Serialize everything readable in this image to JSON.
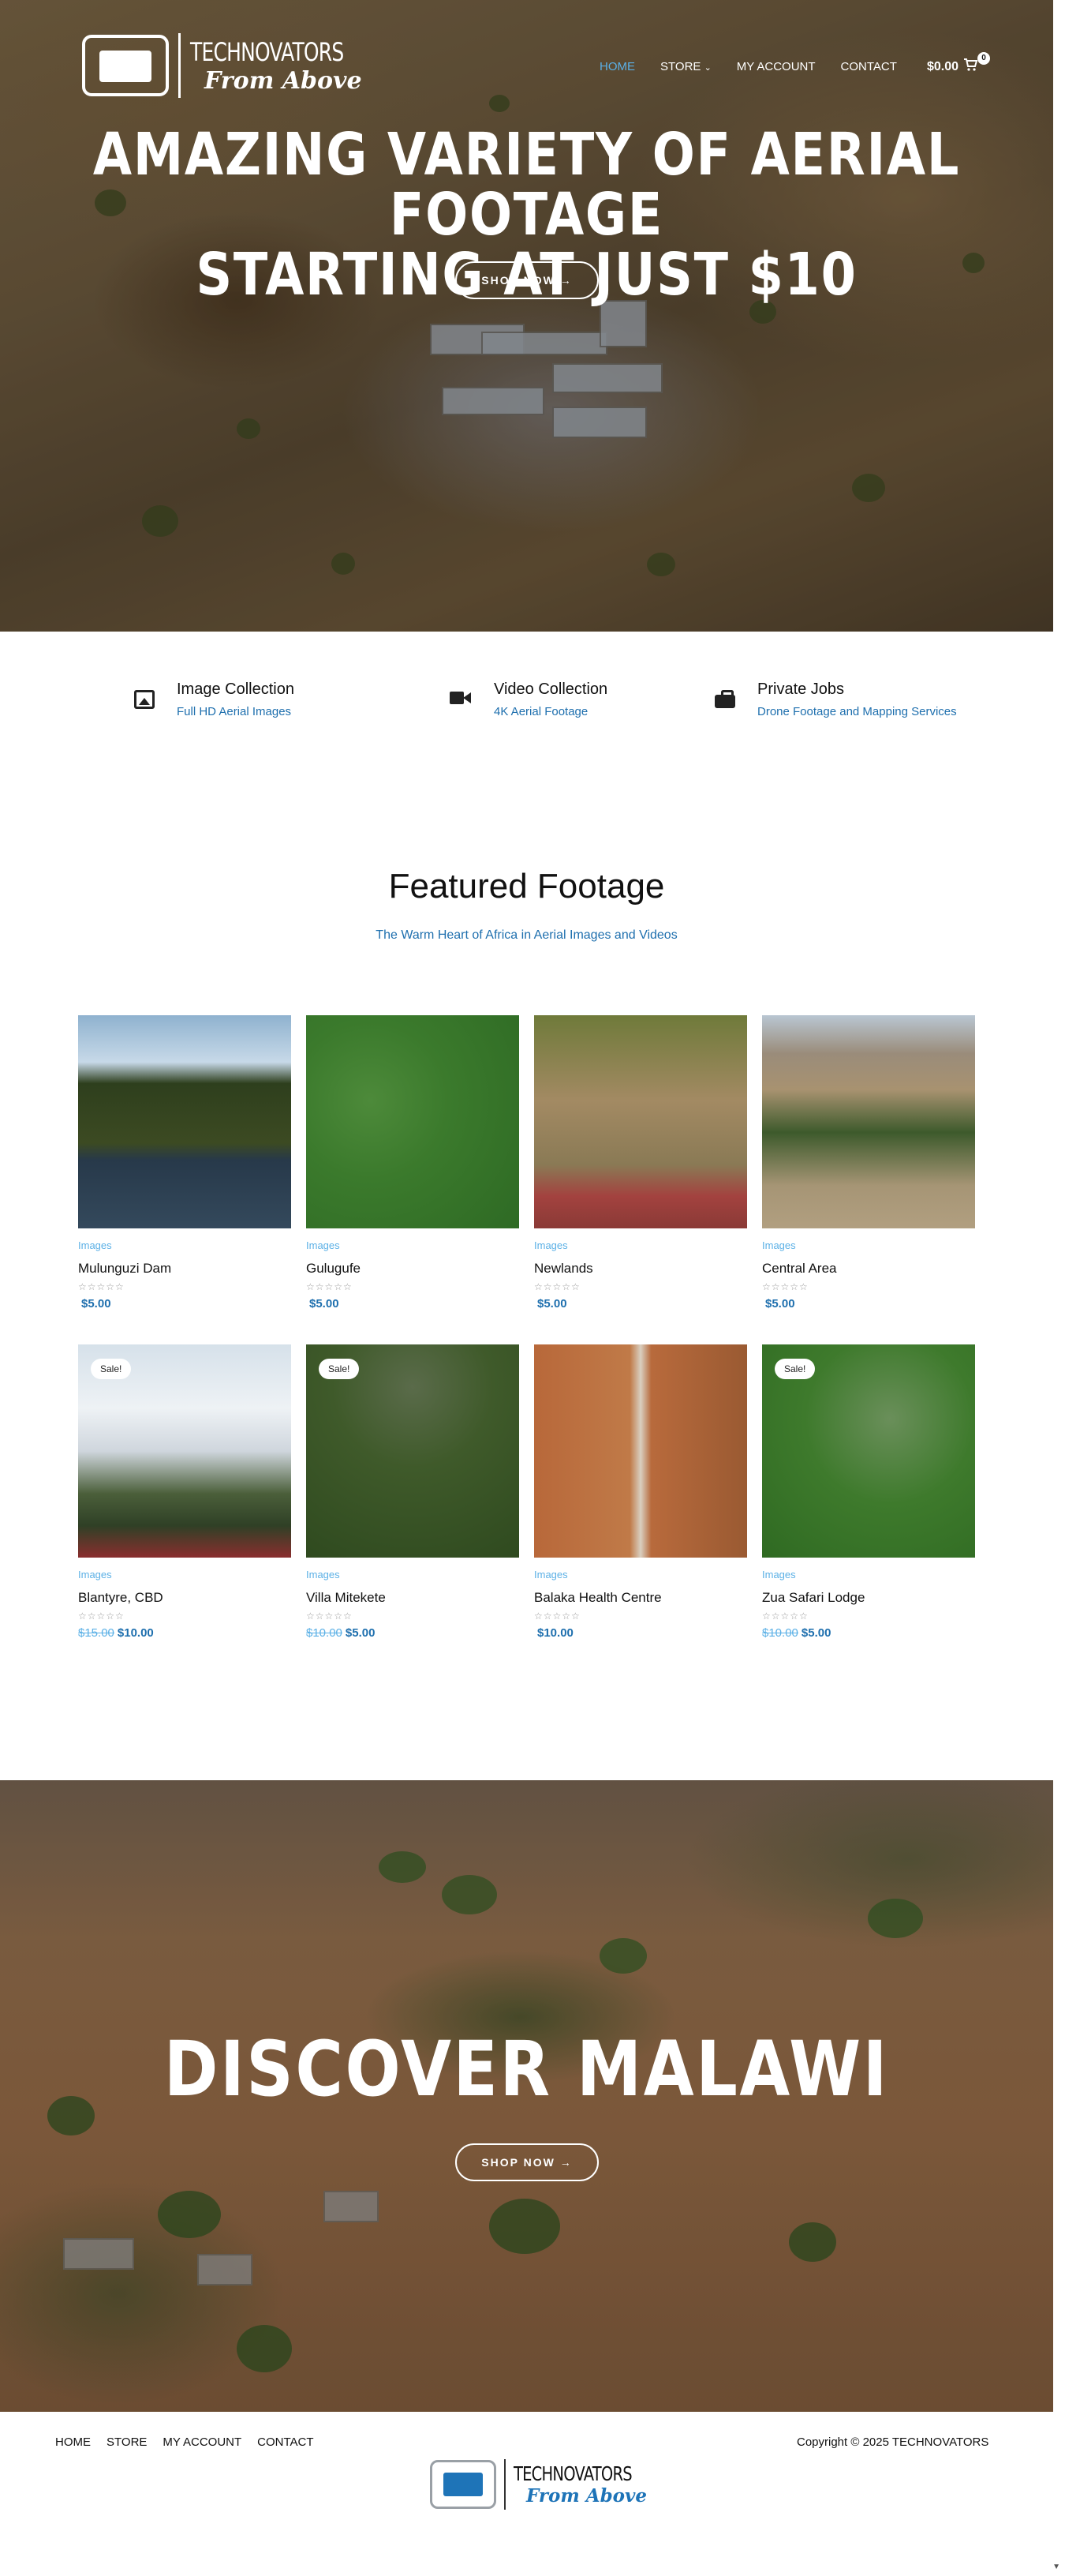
{
  "brand": {
    "logo_line1": "TECHNOVATORS",
    "logo_line2": "From Above"
  },
  "nav": {
    "items": [
      "HOME",
      "STORE",
      "MY ACCOUNT",
      "CONTACT"
    ],
    "dropdown_icon": "chevron-down-icon",
    "cart_total": "$0.00",
    "cart_count": "0",
    "cart_icon": "cart-icon"
  },
  "hero": {
    "title_line1": "AMAZING VARIETY OF AERIAL FOOTAGE",
    "title_line2": "STARTING AT JUST $10",
    "button": "SHOP NOW →"
  },
  "features": [
    {
      "icon": "image-icon",
      "title": "Image Collection",
      "subtitle": "Full HD Aerial Images"
    },
    {
      "icon": "video-camera-icon",
      "title": "Video Collection",
      "subtitle": "4K Aerial Footage"
    },
    {
      "icon": "briefcase-icon",
      "title": "Private Jobs",
      "subtitle": "Drone Footage and Mapping Services"
    }
  ],
  "featured": {
    "title": "Featured Footage",
    "subtitle": "The Warm Heart of Africa in Aerial Images and Videos",
    "stars": "☆☆☆☆☆",
    "products": [
      {
        "category": "Images",
        "name": "Mulunguzi Dam",
        "old_price": "",
        "price": "$5.00",
        "sale": ""
      },
      {
        "category": "Images",
        "name": "Gulugufe",
        "old_price": "",
        "price": "$5.00",
        "sale": ""
      },
      {
        "category": "Images",
        "name": "Newlands",
        "old_price": "",
        "price": "$5.00",
        "sale": ""
      },
      {
        "category": "Images",
        "name": "Central Area",
        "old_price": "",
        "price": "$5.00",
        "sale": ""
      },
      {
        "category": "Images",
        "name": "Blantyre, CBD",
        "old_price": "$15.00",
        "price": "$10.00",
        "sale": "Sale!"
      },
      {
        "category": "Images",
        "name": "Villa Mitekete",
        "old_price": "$10.00",
        "price": "$5.00",
        "sale": "Sale!"
      },
      {
        "category": "Images",
        "name": "Balaka Health Centre",
        "old_price": "",
        "price": "$10.00",
        "sale": ""
      },
      {
        "category": "Images",
        "name": "Zua Safari Lodge",
        "old_price": "$10.00",
        "price": "$5.00",
        "sale": "Sale!"
      }
    ]
  },
  "discover": {
    "title": "DISCOVER MALAWI",
    "button": "SHOP NOW →"
  },
  "footer": {
    "nav": [
      "HOME",
      "STORE",
      "MY ACCOUNT",
      "CONTACT"
    ],
    "copyright": "Copyright © 2025  TECHNOVATORS",
    "logo_line1": "TECHNOVATORS",
    "logo_line2": "From Above"
  }
}
